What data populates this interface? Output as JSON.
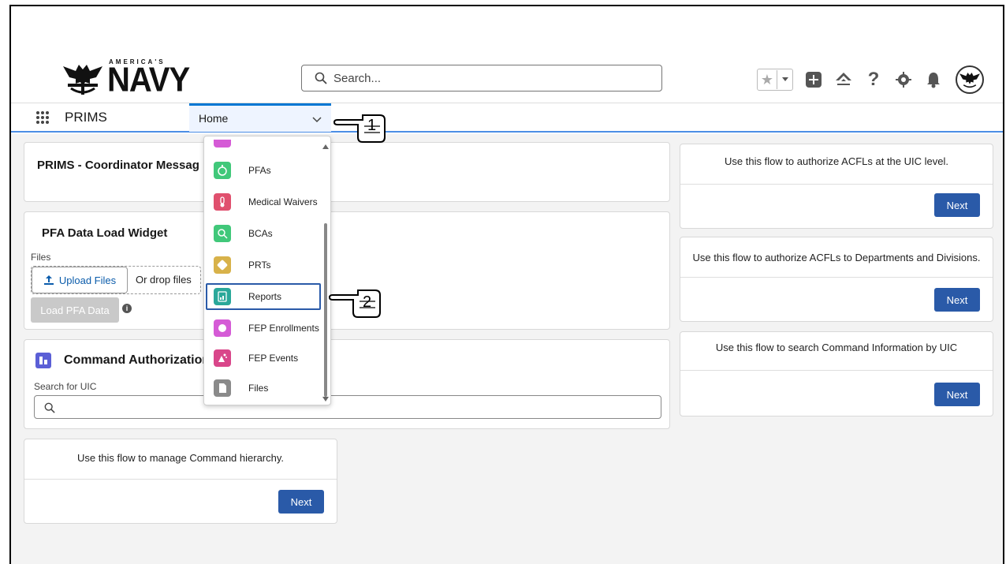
{
  "header": {
    "logo_top": "AMERICA'S",
    "logo_main": "NAVY",
    "search_placeholder": "Search...",
    "icons": [
      "star-icon",
      "chevron-down-icon",
      "add-icon",
      "trailhead-icon",
      "help-icon",
      "gear-icon",
      "bell-icon",
      "avatar"
    ]
  },
  "nav": {
    "app_name": "PRIMS",
    "home_tab": "Home"
  },
  "menu": {
    "items": [
      {
        "label": "PFAs",
        "color": "#41c87a"
      },
      {
        "label": "Medical Waivers",
        "color": "#e0506e"
      },
      {
        "label": "BCAs",
        "color": "#41c87a"
      },
      {
        "label": "PRTs",
        "color": "#d8b24a"
      },
      {
        "label": "Reports",
        "color": "#2aa89a"
      },
      {
        "label": "FEP Enrollments",
        "color": "#d55bd6"
      },
      {
        "label": "FEP Events",
        "color": "#d9468a"
      },
      {
        "label": "Files",
        "color": "#8a8a8a"
      }
    ]
  },
  "cards": {
    "coordinator_title": "PRIMS - Coordinator Messag",
    "pfa_title": "PFA Data Load Widget",
    "files_label": "Files",
    "upload_label": "Upload Files",
    "drop_label": "Or drop files",
    "load_label": "Load PFA Data",
    "command_title": "Command Authorizatior",
    "uic_label": "Search for UIC",
    "hierarchy_text": "Use this flow to manage Command hierarchy.",
    "next": "Next",
    "flow_uic": "Use this flow to authorize ACFLs at the UIC level.",
    "flow_dept": "Use this flow to authorize ACFLs to Departments and Divisions.",
    "flow_search": "Use this flow to search Command Information by UIC"
  },
  "callouts": {
    "one": "1",
    "two": "2"
  },
  "colors": {
    "brand_blue": "#2a5aa8",
    "nav_underline": "#4c8ee5"
  }
}
